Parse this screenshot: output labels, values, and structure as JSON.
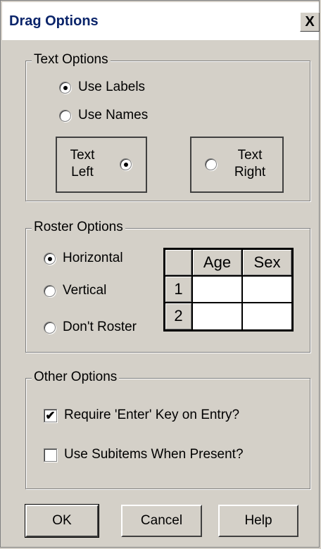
{
  "window": {
    "title": "Drag Options",
    "close_glyph": "X"
  },
  "text_options": {
    "legend": "Text Options",
    "use_labels": "Use Labels",
    "use_names": "Use Names",
    "selected": "use_labels",
    "text_left_line1": "Text",
    "text_left_line2": "Left",
    "text_right_line1": "Text",
    "text_right_line2": "Right",
    "alignment_selected": "left"
  },
  "roster_options": {
    "legend": "Roster Options",
    "horizontal": "Horizontal",
    "vertical": "Vertical",
    "dont_roster": "Don't Roster",
    "selected": "horizontal",
    "preview": {
      "columns": [
        "Age",
        "Sex"
      ],
      "rows": [
        "1",
        "2"
      ]
    }
  },
  "other_options": {
    "legend": "Other Options",
    "require_enter": "Require 'Enter' Key on Entry?",
    "require_enter_checked": true,
    "use_subitems": "Use Subitems When Present?",
    "use_subitems_checked": false,
    "check_glyph": "✔"
  },
  "buttons": {
    "ok": "OK",
    "cancel": "Cancel",
    "help": "Help"
  }
}
